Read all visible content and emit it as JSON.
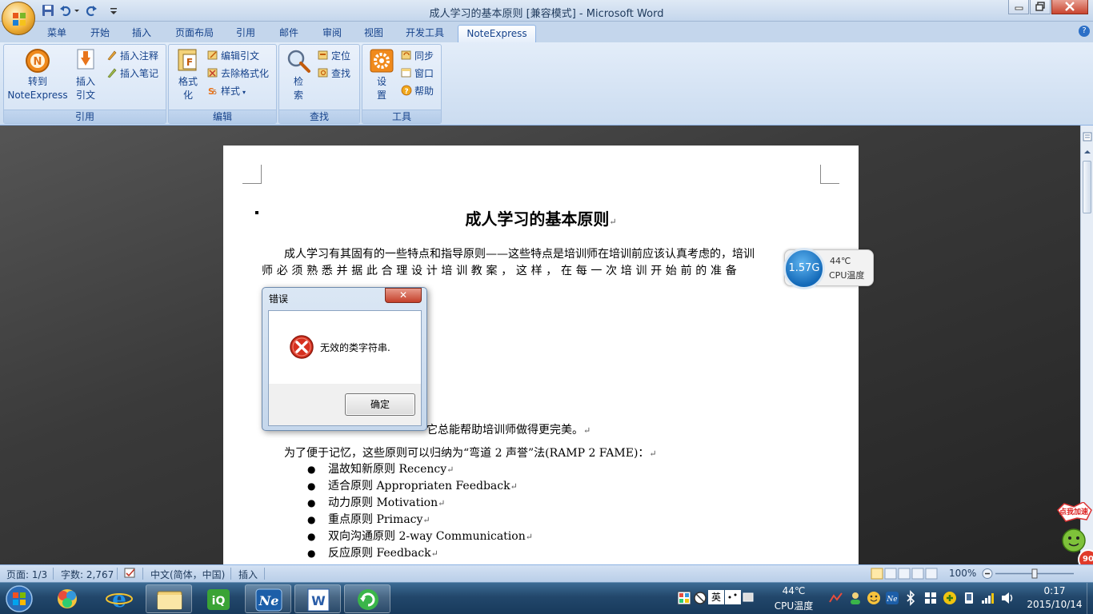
{
  "window": {
    "title": "成人学习的基本原则 [兼容模式] - Microsoft Word"
  },
  "tabs": [
    "菜单",
    "开始",
    "插入",
    "页面布局",
    "引用",
    "邮件",
    "审阅",
    "视图",
    "开发工具",
    "NoteExpress"
  ],
  "active_tab": "NoteExpress",
  "ribbon": {
    "groups": {
      "cite": {
        "label": "引用",
        "goto_line1": "转到",
        "goto_line2": "NoteExpress",
        "insert_line1": "插入",
        "insert_line2": "引文",
        "insert_note": "插入注释",
        "insert_memo": "插入笔记"
      },
      "edit": {
        "label": "编辑",
        "format_line1": "格式",
        "format_line2": "化",
        "edit_citation": "编辑引文",
        "remove_format": "去除格式化",
        "style": "样式"
      },
      "find": {
        "label": "查找",
        "search_line1": "检",
        "search_line2": "索",
        "locate": "定位",
        "find": "查找"
      },
      "tools": {
        "label": "工具",
        "settings_line1": "设",
        "settings_line2": "置",
        "sync": "同步",
        "window": "窗口",
        "help": "帮助"
      }
    }
  },
  "document": {
    "title": "成人学习的基本原则",
    "para1_line1": "成人学习有其固有的一些特点和指导原则——这些特点是培训师在培训前应该认真考虑的，培训",
    "para1_line2": "师必须熟悉并据此合理设计培训教案，这样，在每一次培训开始前的准备",
    "para_after_dialog": "它总能帮助培训师做得更完美。",
    "para2": "为了便于记忆，这些原则可以归纳为“弯道 2 声誉”法(RAMP 2 FAME)：",
    "bullets": [
      "温故知新原则 Recency",
      "适合原则 Appropriaten Feedback",
      "动力原则 Motivation",
      "重点原则 Primacy",
      "双向沟通原则 2-way Communication",
      "反应原则 Feedback"
    ]
  },
  "cpu_widget": {
    "freq": "1.57G",
    "temp": "44℃",
    "label": "CPU温度"
  },
  "dialog": {
    "title": "错误",
    "message": "无效的类字符串.",
    "ok_label": "确定"
  },
  "speed_widget": {
    "label": "点我加速",
    "value": "90"
  },
  "statusbar": {
    "page": "页面: 1/3",
    "words": "字数: 2,767",
    "language": "中文(简体，中国)",
    "mode": "插入",
    "zoom": "100%"
  },
  "taskbar": {
    "ime": "英",
    "temp": "44℃",
    "temp_label": "CPU温度",
    "time": "0:17",
    "date": "2015/10/14"
  },
  "colors": {
    "ribbon_text": "#15428b",
    "error_red": "#c4402a",
    "taskbar": "#22476b"
  }
}
